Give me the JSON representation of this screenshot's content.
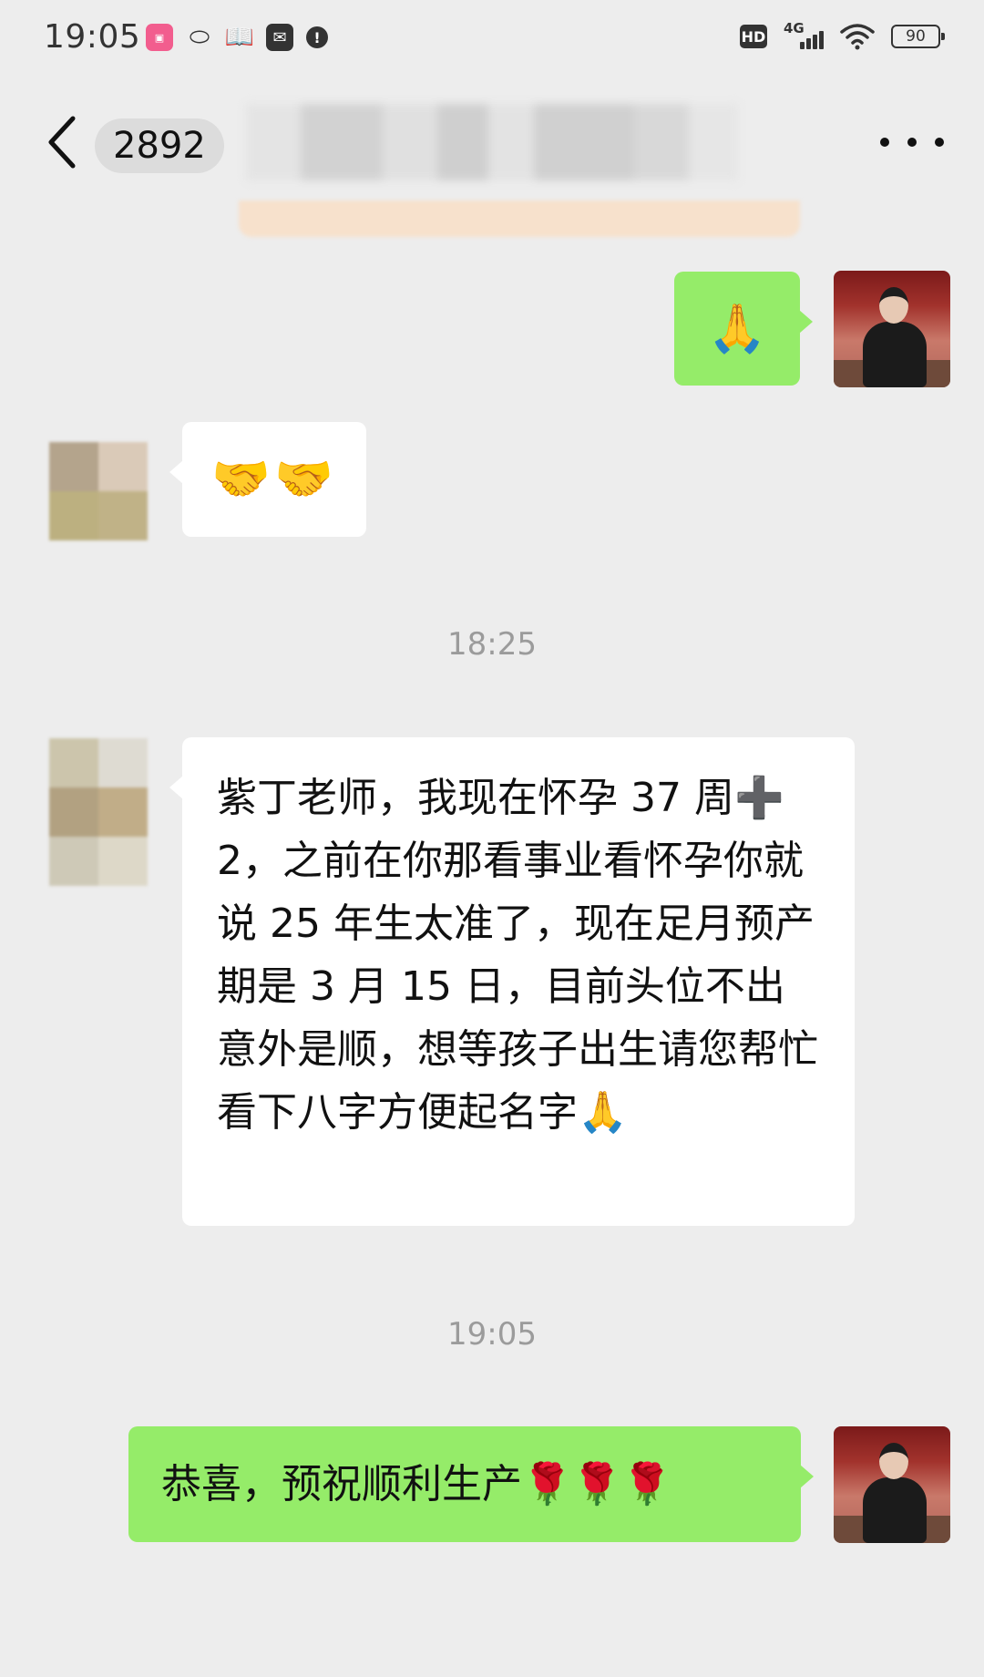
{
  "status_bar": {
    "time": "19:05",
    "network_label": "4G",
    "hd_label": "HD",
    "battery_level": "90",
    "app_icons": [
      "bilibili-icon",
      "rugby-icon",
      "book-icon",
      "mail-icon",
      "alert-icon"
    ]
  },
  "header": {
    "unread_count": "2892",
    "title": ""
  },
  "messages": [
    {
      "direction": "outgoing",
      "content": "🙏"
    },
    {
      "direction": "incoming",
      "content": "🤝🤝"
    },
    {
      "timestamp": "18:25"
    },
    {
      "direction": "incoming",
      "content": "紫丁老师，我现在怀孕 37 周➕2，之前在你那看事业看怀孕你就说 25 年生太准了，现在足月预产期是 3 月 15 日，目前头位不出意外是顺，想等孩子出生请您帮忙看下八字方便起名字🙏"
    },
    {
      "timestamp": "19:05"
    },
    {
      "direction": "outgoing",
      "content": "恭喜，预祝顺利生产🌹🌹🌹"
    }
  ],
  "colors": {
    "background": "#ededed",
    "outgoing_bubble": "#95ec69",
    "incoming_bubble": "#ffffff",
    "timestamp_text": "#9b9b9b"
  }
}
